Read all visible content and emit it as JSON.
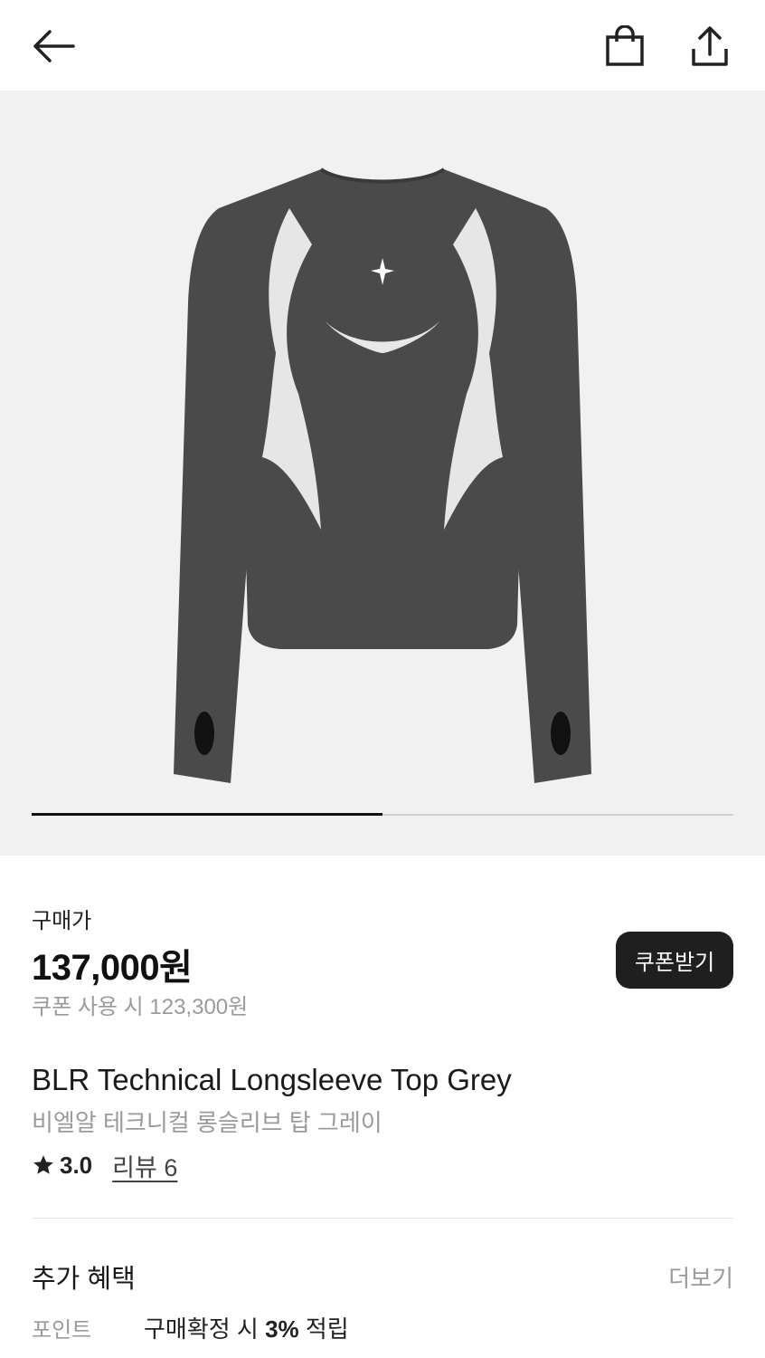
{
  "header": {
    "back_icon": "arrow-left-icon",
    "bag_icon": "shopping-bag-icon",
    "share_icon": "share-upload-icon"
  },
  "gallery": {
    "progress_fraction": 0.5
  },
  "price": {
    "label": "구매가",
    "value": "137,000원",
    "coupon_note": "쿠폰 사용 시 123,300원",
    "coupon_button": "쿠폰받기"
  },
  "product": {
    "title_en": "BLR Technical Longsleeve Top Grey",
    "title_ko": "비엘알 테크니컬 롱슬리브 탑 그레이",
    "rating": "3.0",
    "review_link": "리뷰 6"
  },
  "benefits": {
    "title": "추가 혜택",
    "more": "더보기",
    "rows": [
      {
        "label": "포인트",
        "value_prefix": "구매확정 시 ",
        "value_bold": "3%",
        "value_suffix": " 적립"
      }
    ],
    "partial_row": "…"
  },
  "colors": {
    "accent_dark": "#1f1f1f",
    "gallery_bg": "#f1f1f1",
    "muted_text": "#9a9a9a"
  }
}
